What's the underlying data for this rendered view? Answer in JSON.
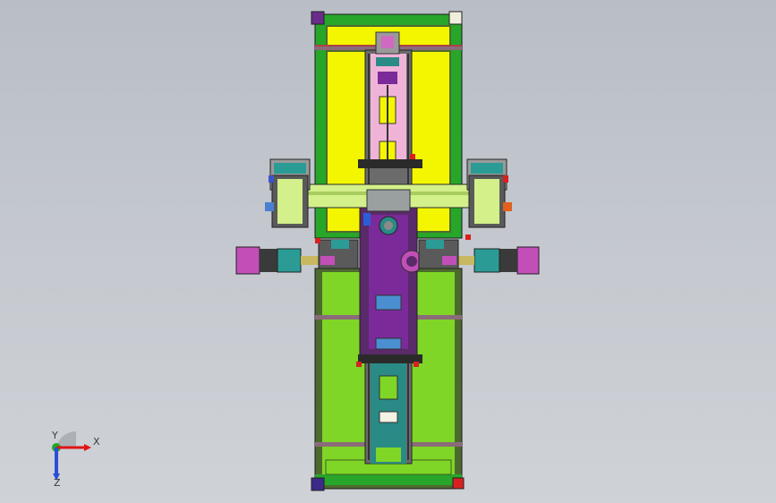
{
  "viewport": {
    "background_top": "#b9bec6",
    "background_bottom": "#cfd2d7"
  },
  "colors": {
    "frame_green": "#27a62a",
    "frame_dark": "#4d6a2e",
    "panel_yellow": "#f4f600",
    "panel_green": "#7fd626",
    "rail_pink": "#f0b3d8",
    "carriage_purple": "#7a2a99",
    "beam_lightgreen": "#d3f08a",
    "motor_magenta": "#c24fb8",
    "teal": "#2b9b95",
    "axis_x": "#e01515",
    "axis_y": "#22a722",
    "axis_z": "#2a4ed8"
  },
  "triad": {
    "x_label": "X",
    "y_label": "Y",
    "z_label": "Z"
  }
}
